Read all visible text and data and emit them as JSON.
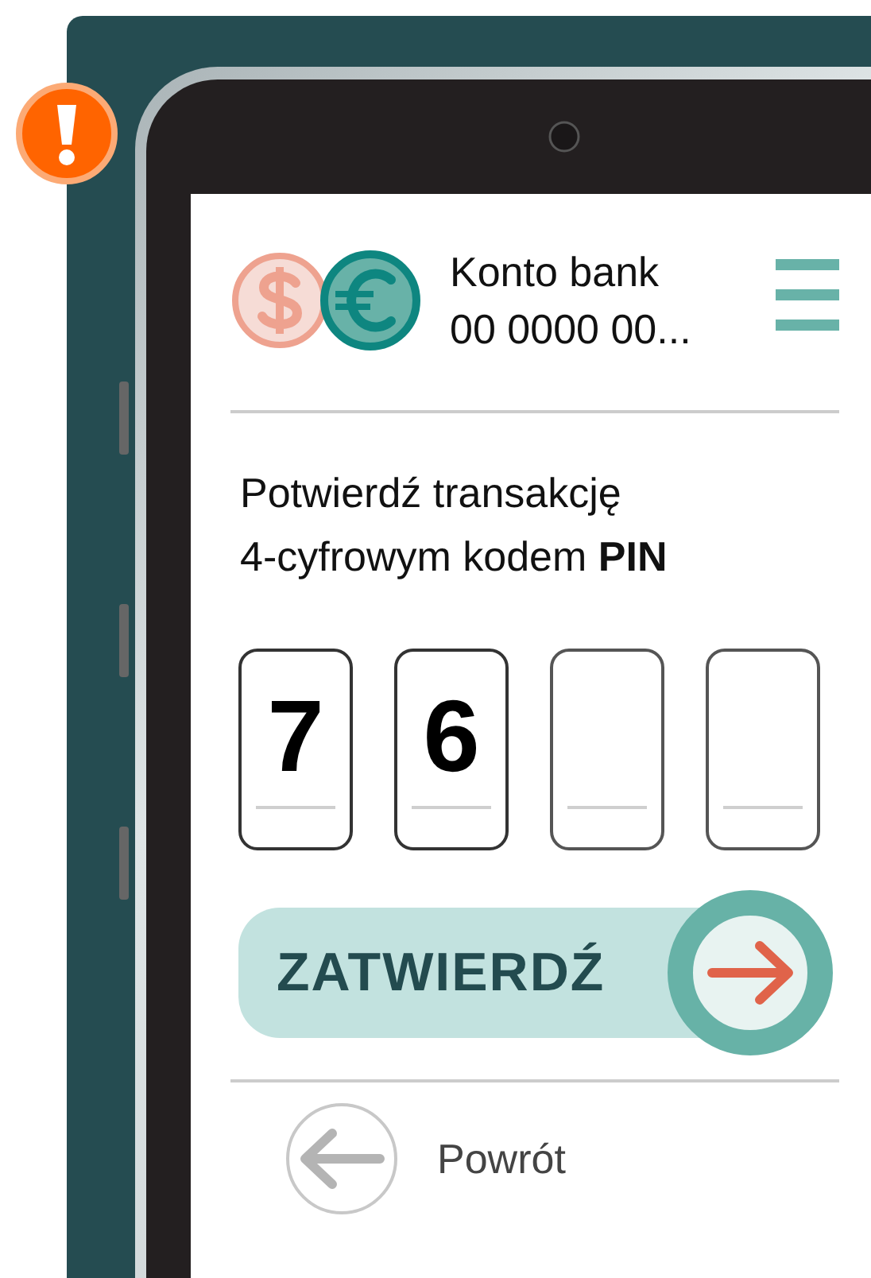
{
  "account": {
    "name": "Konto bank",
    "number": "00 0000 00..."
  },
  "prompt": "Potwierdź transakcję\n4-cyfrowym kodem **PIN**",
  "pin": [
    {
      "digit": "7",
      "filled": true
    },
    {
      "digit": "6",
      "filled": true
    },
    {
      "filled": false
    },
    {
      "filled": false
    }
  ],
  "confirm_button": {
    "label": "ZATWIERDŹ"
  },
  "back_button": {
    "label": "Powrót"
  }
}
